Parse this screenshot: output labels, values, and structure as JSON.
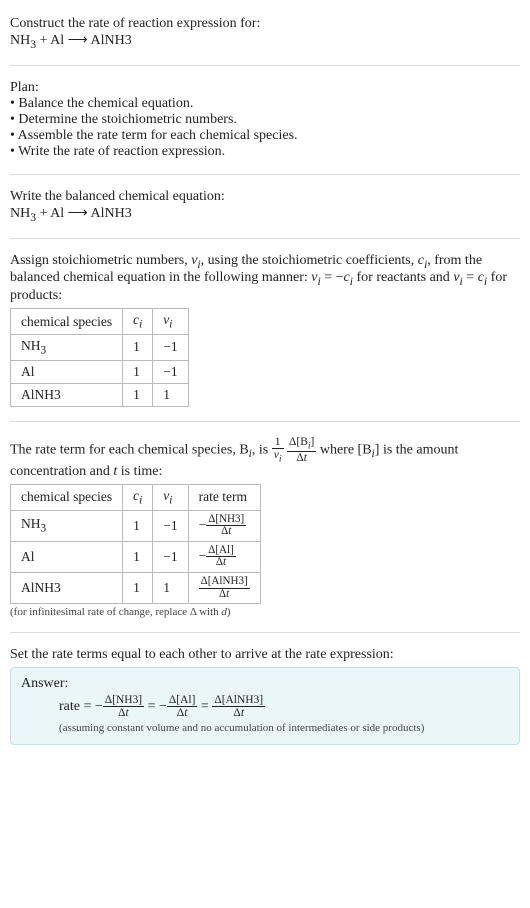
{
  "prompt": {
    "line1": "Construct the rate of reaction expression for:",
    "equation_html": "NH<sub>3</sub> + Al ⟶ AlNH3"
  },
  "plan": {
    "heading": "Plan:",
    "items": [
      "Balance the chemical equation.",
      "Determine the stoichiometric numbers.",
      "Assemble the rate term for each chemical species.",
      "Write the rate of reaction expression."
    ]
  },
  "balanced": {
    "heading": "Write the balanced chemical equation:",
    "equation_html": "NH<sub>3</sub> + Al ⟶ AlNH3"
  },
  "assign": {
    "text_html": "Assign stoichiometric numbers, <i>ν<sub>i</sub></i>, using the stoichiometric coefficients, <i>c<sub>i</sub></i>, from the balanced chemical equation in the following manner: <i>ν<sub>i</sub></i> = −<i>c<sub>i</sub></i> for reactants and <i>ν<sub>i</sub></i> = <i>c<sub>i</sub></i> for products:",
    "headers": {
      "species": "chemical species",
      "ci_html": "<i>c<sub>i</sub></i>",
      "vi_html": "<i>ν<sub>i</sub></i>"
    },
    "rows": [
      {
        "species_html": "NH<sub>3</sub>",
        "ci": "1",
        "vi": "−1"
      },
      {
        "species_html": "Al",
        "ci": "1",
        "vi": "−1"
      },
      {
        "species_html": "AlNH3",
        "ci": "1",
        "vi": "1"
      }
    ]
  },
  "rateterm": {
    "text_pre": "The rate term for each chemical species, B",
    "text_mid1": ", is ",
    "text_mid2": " where [B",
    "text_post": "] is the amount concentration and ",
    "t_is_time": " is time:",
    "headers": {
      "species": "chemical species",
      "ci_html": "<i>c<sub>i</sub></i>",
      "vi_html": "<i>ν<sub>i</sub></i>",
      "rate": "rate term"
    },
    "rows": [
      {
        "species_html": "NH<sub>3</sub>",
        "ci": "1",
        "vi": "−1",
        "rate_num": "Δ[NH3]",
        "rate_den": "Δ<i>t</i>",
        "neg": "−"
      },
      {
        "species_html": "Al",
        "ci": "1",
        "vi": "−1",
        "rate_num": "Δ[Al]",
        "rate_den": "Δ<i>t</i>",
        "neg": "−"
      },
      {
        "species_html": "AlNH3",
        "ci": "1",
        "vi": "1",
        "rate_num": "Δ[AlNH3]",
        "rate_den": "Δ<i>t</i>",
        "neg": ""
      }
    ],
    "note_html": "(for infinitesimal rate of change, replace Δ with <i>d</i>)"
  },
  "setequal": {
    "text": "Set the rate terms equal to each other to arrive at the rate expression:"
  },
  "answer": {
    "label": "Answer:",
    "prefix": "rate = ",
    "terms": [
      {
        "neg": "−",
        "num": "Δ[NH3]",
        "den": "Δ<i>t</i>"
      },
      {
        "neg": "−",
        "num": "Δ[Al]",
        "den": "Δ<i>t</i>"
      },
      {
        "neg": "",
        "num": "Δ[AlNH3]",
        "den": "Δ<i>t</i>"
      }
    ],
    "note": "(assuming constant volume and no accumulation of intermediates or side products)"
  }
}
